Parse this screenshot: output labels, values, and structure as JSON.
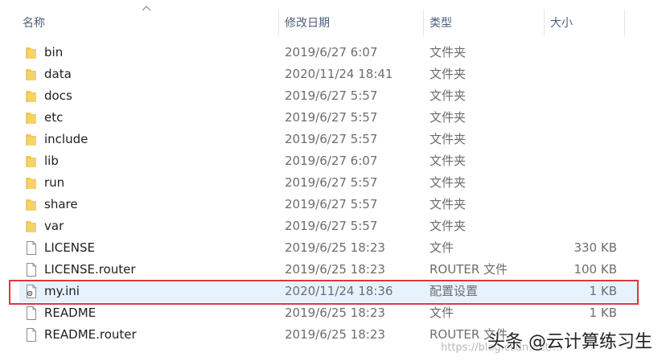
{
  "columns": {
    "name": "名称",
    "date": "修改日期",
    "type": "类型",
    "size": "大小"
  },
  "files": [
    {
      "name": "bin",
      "date": "2019/6/27 6:07",
      "type": "文件夹",
      "size": "",
      "icon": "folder-icon"
    },
    {
      "name": "data",
      "date": "2020/11/24 18:41",
      "type": "文件夹",
      "size": "",
      "icon": "folder-icon"
    },
    {
      "name": "docs",
      "date": "2019/6/27 5:57",
      "type": "文件夹",
      "size": "",
      "icon": "folder-icon"
    },
    {
      "name": "etc",
      "date": "2019/6/27 5:57",
      "type": "文件夹",
      "size": "",
      "icon": "folder-icon"
    },
    {
      "name": "include",
      "date": "2019/6/27 5:57",
      "type": "文件夹",
      "size": "",
      "icon": "folder-icon"
    },
    {
      "name": "lib",
      "date": "2019/6/27 6:07",
      "type": "文件夹",
      "size": "",
      "icon": "folder-icon"
    },
    {
      "name": "run",
      "date": "2019/6/27 5:57",
      "type": "文件夹",
      "size": "",
      "icon": "folder-icon"
    },
    {
      "name": "share",
      "date": "2019/6/27 5:57",
      "type": "文件夹",
      "size": "",
      "icon": "folder-icon"
    },
    {
      "name": "var",
      "date": "2019/6/27 5:57",
      "type": "文件夹",
      "size": "",
      "icon": "folder-icon"
    },
    {
      "name": "LICENSE",
      "date": "2019/6/25 18:23",
      "type": "文件",
      "size": "330 KB",
      "icon": "file-icon"
    },
    {
      "name": "LICENSE.router",
      "date": "2019/6/25 18:23",
      "type": "ROUTER 文件",
      "size": "100 KB",
      "icon": "file-icon"
    },
    {
      "name": "my.ini",
      "date": "2020/11/24 18:36",
      "type": "配置设置",
      "size": "1 KB",
      "icon": "settings-file-icon",
      "selected": true
    },
    {
      "name": "README",
      "date": "2019/6/25 18:23",
      "type": "文件",
      "size": "1 KB",
      "icon": "file-icon"
    },
    {
      "name": "README.router",
      "date": "2019/6/25 18:23",
      "type": "ROUTER 文件",
      "size": "",
      "icon": "file-icon"
    }
  ],
  "watermark": "头条 @云计算练习生",
  "watermark_faint": "https://blog.csdn.net/..."
}
